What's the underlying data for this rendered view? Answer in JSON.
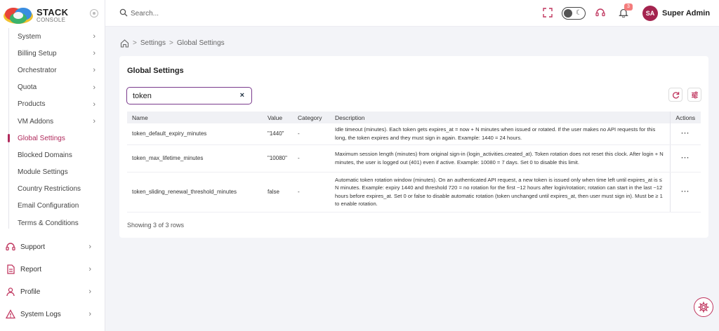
{
  "logo": {
    "title": "STACK",
    "subtitle": "CONSOLE"
  },
  "sidebar": {
    "submenu": [
      {
        "label": "System"
      },
      {
        "label": "Billing Setup"
      },
      {
        "label": "Orchestrator"
      },
      {
        "label": "Quota"
      },
      {
        "label": "Products"
      },
      {
        "label": "VM Addons"
      },
      {
        "label": "Global Settings"
      },
      {
        "label": "Blocked Domains"
      },
      {
        "label": "Module Settings"
      },
      {
        "label": "Country Restrictions"
      },
      {
        "label": "Email Configuration"
      },
      {
        "label": "Terms & Conditions"
      }
    ],
    "chevron": "›",
    "menu": [
      {
        "label": "Support",
        "icon": "headset-icon"
      },
      {
        "label": "Report",
        "icon": "report-icon"
      },
      {
        "label": "Profile",
        "icon": "user-icon"
      },
      {
        "label": "System Logs",
        "icon": "warning-icon"
      }
    ]
  },
  "topbar": {
    "search_placeholder": "Search...",
    "notification_count": "3",
    "avatar_initials": "SA",
    "user_name": "Super Admin"
  },
  "breadcrumb": {
    "items": [
      "Settings",
      "Global Settings"
    ],
    "sep": ">"
  },
  "page": {
    "title": "Global Settings",
    "filter_value": "token",
    "clear_symbol": "×",
    "columns": {
      "name": "Name",
      "value": "Value",
      "category": "Category",
      "description": "Description",
      "actions": "Actions"
    },
    "rows": [
      {
        "name": "token_default_expiry_minutes",
        "value": "\"1440\"",
        "category": "-",
        "description": "Idle timeout (minutes). Each token gets expires_at = now + N minutes when issued or rotated. If the user makes no API requests for this long, the token expires and they must sign in again. Example: 1440 = 24 hours.",
        "action": "···"
      },
      {
        "name": "token_max_lifetime_minutes",
        "value": "\"10080\"",
        "category": "-",
        "description": "Maximum session length (minutes) from original sign-in (login_activities.created_at). Token rotation does not reset this clock. After login + N minutes, the user is logged out (401) even if active. Example: 10080 = 7 days. Set 0 to disable this limit.",
        "action": "···"
      },
      {
        "name": "token_sliding_renewal_threshold_minutes",
        "value": "false",
        "category": "-",
        "description": "Automatic token rotation window (minutes). On an authenticated API request, a new token is issued only when time left until expires_at is ≤ N minutes. Example: expiry 1440 and threshold 720 = no rotation for the first ~12 hours after login/rotation; rotation can start in the last ~12 hours before expires_at. Set 0 or false to disable automatic rotation (token unchanged until expires_at, then user must sign in). Must be ≥ 1 to enable rotation.",
        "action": "···"
      }
    ],
    "rows_info": "Showing 3 of 3 rows"
  },
  "colors": {
    "accent": "#c0365f",
    "avatar": "#a4244f",
    "filter_border": "#7a3a8c"
  }
}
